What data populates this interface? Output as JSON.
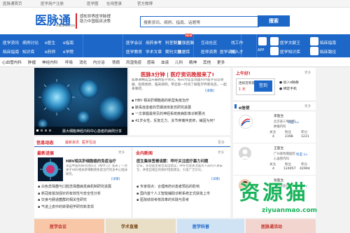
{
  "topbar": {
    "items": [
      "医脉通首页",
      "医学用户注册",
      "医学圈",
      "在线登录",
      "官方微博"
    ]
  },
  "header": {
    "logo": "医脉通",
    "logo_sub": "medlive.cn",
    "slogan_line1": "感知世界医学脉搏",
    "slogan_line2": "助力中国临床决策",
    "search_placeholder": "搜索资讯、病例、指南、话题等",
    "search_button": "搜索"
  },
  "nav": {
    "col1": [
      "医学资讯",
      "病例讨论",
      "临床指南",
      "知识库"
    ],
    "col2": [
      "e医生",
      "e指南",
      "e药师",
      "e学院"
    ],
    "col3": [
      "医学会议",
      "医学教育",
      "学术文章",
      "期刊文献"
    ],
    "col4": [
      "用药参考",
      "科室联盟",
      "最强医脑",
      "数据库"
    ],
    "col5": [
      "互动社区",
      "医师资质",
      "医学调研",
      "医学圈"
    ],
    "col6": [
      "找工作",
      "找人才",
      "找医生"
    ],
    "col7": [
      "医学文献王",
      "医学知识库",
      "临床指南",
      "临床路径"
    ],
    "apps_label": "APP",
    "badge": "NEW"
  },
  "catbar": {
    "items": [
      "心血管内科",
      "肿瘤",
      "神经内科",
      "呼吸",
      "消化",
      "内分泌",
      "肾病",
      "风湿免疫",
      "感染",
      "血液",
      "儿科",
      "精神",
      "其他",
      "更多"
    ]
  },
  "hero": {
    "caption": "晨大细胞神经内科中心患者的病例分享",
    "dots": [
      "1",
      "2",
      "3",
      "4",
      "5"
    ]
  },
  "feature": {
    "title": "医脉3分钟 | 医疗资讯晚报来了!",
    "summary": "医脉通精选当天最新医学资讯，每日为您呈现国内外医学前沿进展、指南更新、临床病例，带您第一时间了解医学界新动态，一起来看吧。",
    "summary_link": "[详情]",
    "bullets": [
      "HBV 相关肝细胞癌的新型免疫治疗",
      "脓毒症患者的早期液体复苏研究进展",
      "一文掌握最常见的神经系统疾病影像诊断要点",
      "41岁女性，反复乏力、关节疼痛伴皮疹，病因为何？"
    ]
  },
  "info_tabs": {
    "active": "信息动态",
    "others": [
      "最新资讯",
      "医学互动"
    ],
    "more": "更多"
  },
  "col_latest": {
    "title": "最新进展",
    "more": "更多",
    "article_title": "HBV相关肝细胞癌的免疫治疗",
    "article_text": "来自中国的研究团队在《柳叶刀》发表了一项关于HBV相关肝细胞癌免疫治疗的多中心临床研究。",
    "article_link": "[详情]",
    "bullets": [
      "白色念珠菌与口腔念珠菌病发病机制研究进展",
      "新冠疫苗加强针的有效性与安全性分析",
      "饮食与肠道菌群的相关性研究",
      "气道上皮中的转录组学研究新发现"
    ]
  },
  "col_industry": {
    "title": "业内新闻",
    "more": "更多",
    "article_title": "医生集体签署请愿：呼吁关注医疗暴力问题",
    "article_text": "近日，多位医生联合发出倡议，呼吁社会关注医务人员的人身安全，并提出相应的保护措施建议，引发广泛讨论。",
    "article_link": "[详情]",
    "bullets": [
      "专家观点：合理用药对患者预后的影响",
      "国内首个人工智能辅助诊断系统正式获批上市",
      "医院绩效考核改革的实践与思考"
    ]
  },
  "sidebar": {
    "signin_title": "上午好!",
    "signin_more": "更多",
    "signin_label": "连续签到第",
    "signin_days": "1 天",
    "signin_button": "签到",
    "signin_options": [
      "加入e脉群",
      "绑定手机"
    ],
    "edoctor_title": "e信使",
    "edoctor_more": "更多",
    "doctors": [
      {
        "name": "李医生",
        "hospital": "北京某三甲医院",
        "dept": "肿瘤内科",
        "titles": [
          "关注",
          "粉丝",
          "积分"
        ],
        "stats": [
          "4",
          "2398",
          "1221"
        ],
        "level": "科室 Lv"
      },
      {
        "name": "王医生",
        "hospital": "广州某附属医院",
        "dept": "心血管内科",
        "titles": [
          "关注",
          "粉丝",
          "积分"
        ],
        "stats": [
          "4",
          "124957",
          "42994"
        ],
        "level": "科室 Lv"
      },
      {
        "name": "张医生",
        "hospital": "上海某医院",
        "dept": "",
        "titles": [
          "",
          "",
          ""
        ],
        "stats": [
          "",
          "",
          ""
        ],
        "level": "科室 Lv"
      }
    ]
  },
  "bottom": {
    "banners": [
      "医学会议",
      "学术直播",
      "医学科普",
      "医脉通活动"
    ]
  },
  "watermark": {
    "text": "资源猫",
    "url": "ziyuanmao.com"
  }
}
